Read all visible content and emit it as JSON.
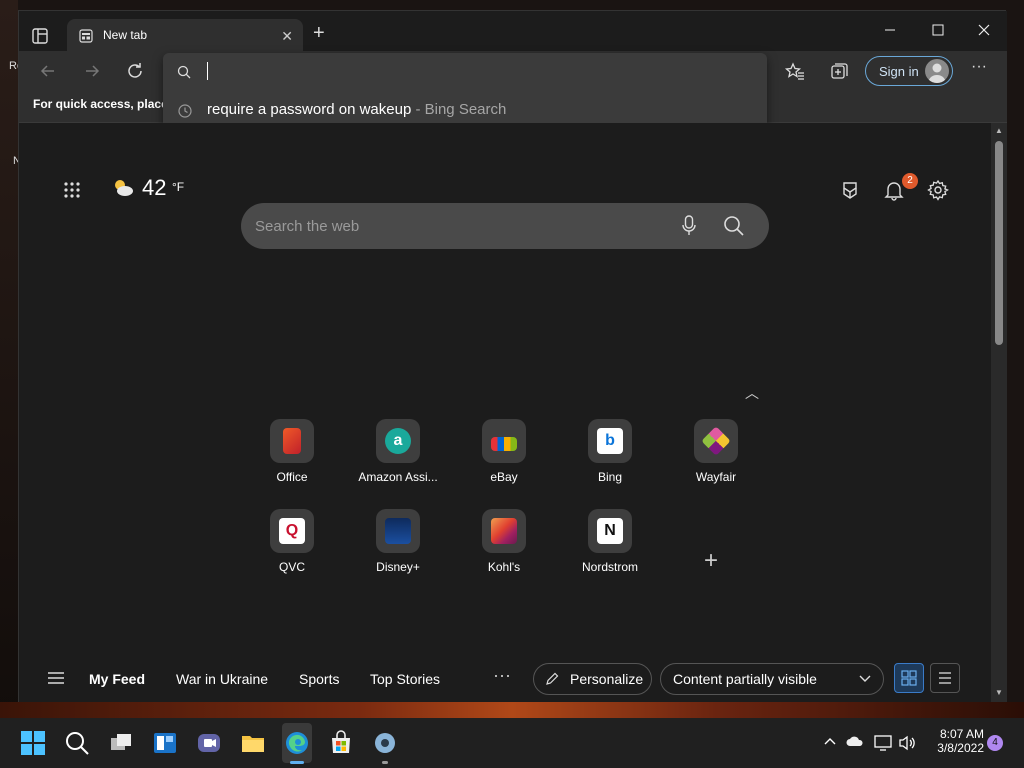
{
  "desktop": {
    "side_text_1": "Re",
    "side_text_2": "N"
  },
  "tab": {
    "title": "New tab"
  },
  "toolbar": {
    "signin_label": "Sign in"
  },
  "favorites_bar": {
    "hint": "For quick access, place y"
  },
  "omnibox": {
    "suggestion": "require a password on wakeup",
    "suggestion_source": "- Bing Search"
  },
  "weather": {
    "temp": "42",
    "unit": "°F"
  },
  "notifications": {
    "count": "2"
  },
  "search": {
    "placeholder": "Search the web"
  },
  "tiles": [
    {
      "label": "Office"
    },
    {
      "label": "Amazon Assi..."
    },
    {
      "label": "eBay"
    },
    {
      "label": "Bing"
    },
    {
      "label": "Wayfair"
    },
    {
      "label": "QVC"
    },
    {
      "label": "Disney+"
    },
    {
      "label": "Kohl's"
    },
    {
      "label": "Nordstrom"
    }
  ],
  "feed": {
    "items": [
      "My Feed",
      "War in Ukraine",
      "Sports",
      "Top Stories"
    ],
    "more": "···",
    "personalize": "Personalize",
    "content_select": "Content partially visible"
  },
  "taskbar": {
    "time": "8:07 AM",
    "date": "3/8/2022",
    "notification_count": "4"
  }
}
